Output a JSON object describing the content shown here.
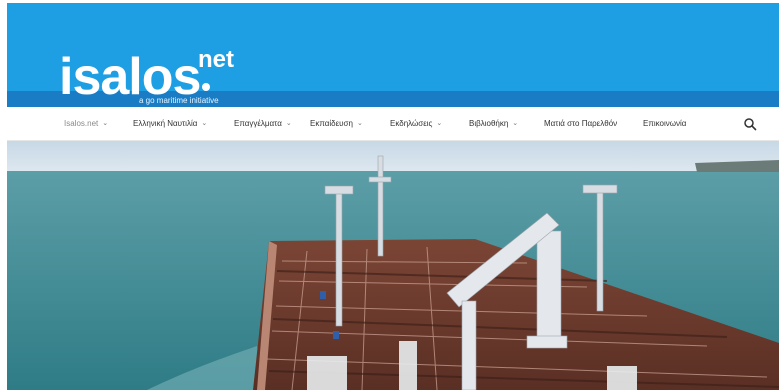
{
  "brand": {
    "logo_main": "isalos",
    "logo_sup": "net",
    "tagline": "a go maritime initiative",
    "colors": {
      "header": "#1f9fe3",
      "header_band": "#1a7cc4",
      "logo_text": "#ffffff"
    }
  },
  "nav": {
    "items": [
      {
        "label": "Isalos.net",
        "has_dropdown": true,
        "active": true
      },
      {
        "label": "Ελληνική Ναυτιλία",
        "has_dropdown": true
      },
      {
        "label": "Επαγγέλματα",
        "has_dropdown": true
      },
      {
        "label": "Εκπαίδευση",
        "has_dropdown": true
      },
      {
        "label": "Εκδηλώσεις",
        "has_dropdown": true
      },
      {
        "label": "Βιβλιοθήκη",
        "has_dropdown": true
      },
      {
        "label": "Ματιά στο Παρελθόν",
        "has_dropdown": false
      },
      {
        "label": "Επικοινωνία",
        "has_dropdown": false
      }
    ],
    "search_icon": "search-icon",
    "dropdown_icon": "chevron-down-icon"
  },
  "hero": {
    "image": "tanker-ship-deck-at-sea",
    "colors": {
      "sky": "#d5e2ee",
      "sea": "#3f8c95",
      "deck": "#6b3a2c"
    }
  }
}
